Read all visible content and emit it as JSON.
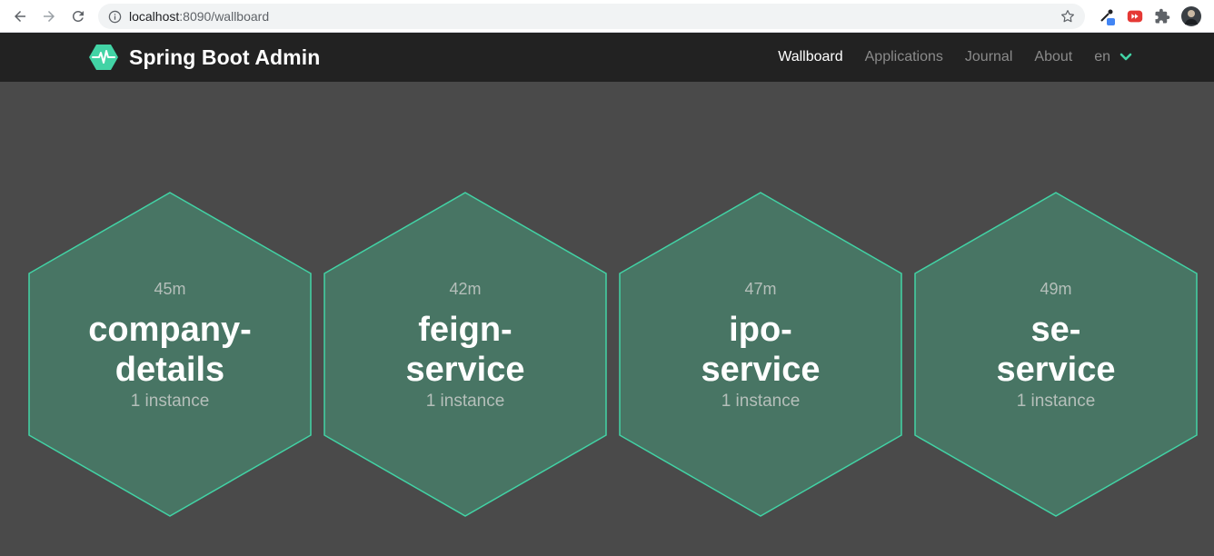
{
  "browser": {
    "url_host": "localhost",
    "url_rest": ":8090/wallboard"
  },
  "app": {
    "title": "Spring Boot Admin",
    "accent_color": "#42d3a5",
    "nav": {
      "wallboard": "Wallboard",
      "applications": "Applications",
      "journal": "Journal",
      "about": "About",
      "language": "en"
    }
  },
  "applications": [
    {
      "uptime": "45m",
      "name_line1": "company-",
      "name_line2": "details",
      "instances": "1 instance"
    },
    {
      "uptime": "42m",
      "name_line1": "feign-",
      "name_line2": "service",
      "instances": "1 instance"
    },
    {
      "uptime": "47m",
      "name_line1": "ipo-",
      "name_line2": "service",
      "instances": "1 instance"
    },
    {
      "uptime": "49m",
      "name_line1": "se-",
      "name_line2": "service",
      "instances": "1 instance"
    }
  ]
}
